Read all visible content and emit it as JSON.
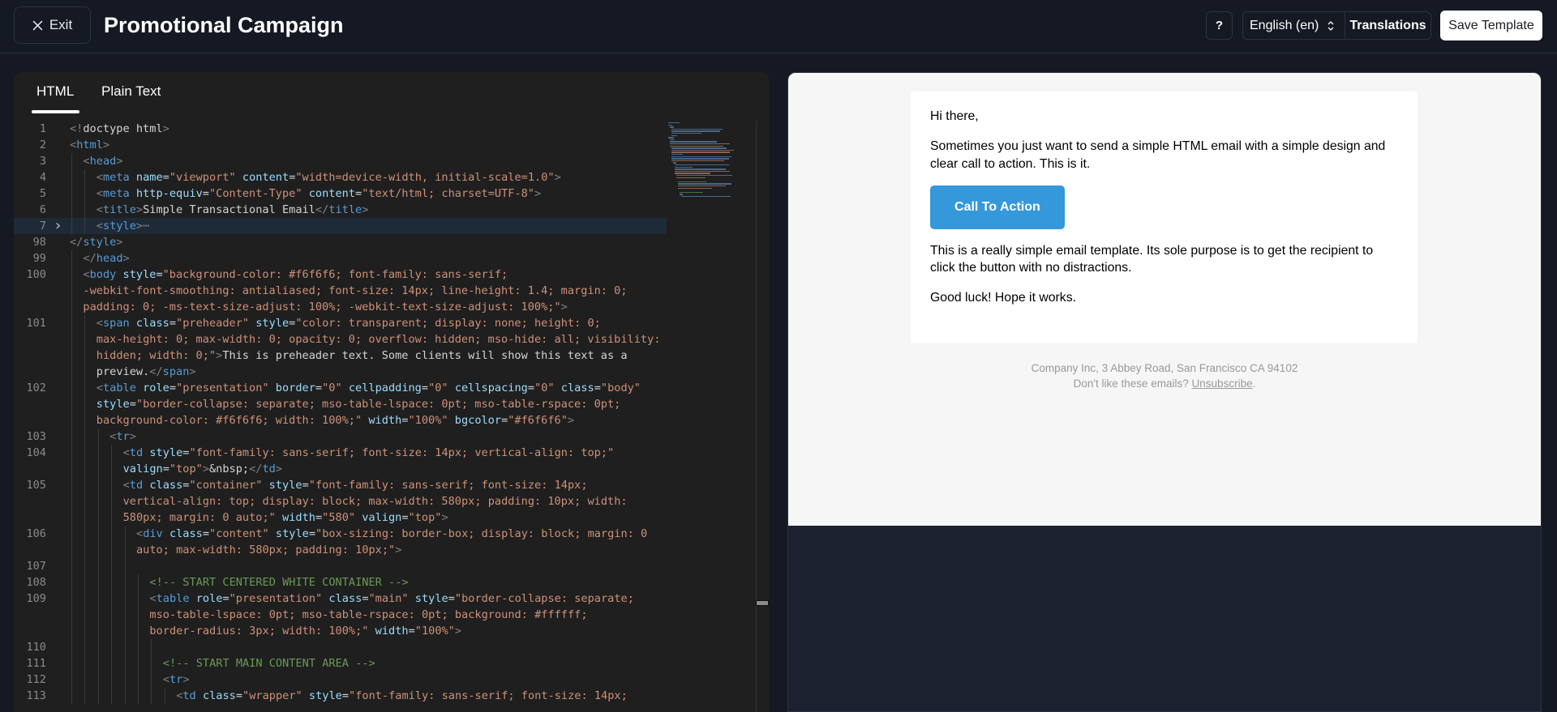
{
  "header": {
    "exit_label": "Exit",
    "title": "Promotional Campaign",
    "help_label": "?",
    "language_selected": "English (en)",
    "translations_label": "Translations",
    "save_label": "Save Template"
  },
  "editor": {
    "tabs": [
      {
        "label": "HTML",
        "active": true
      },
      {
        "label": "Plain Text",
        "active": false
      }
    ],
    "lines": [
      {
        "n": "1",
        "indent": 0,
        "tokens": [
          [
            "p",
            "<!"
          ],
          [
            "txt",
            "doctype html"
          ],
          [
            "p",
            ">"
          ]
        ]
      },
      {
        "n": "2",
        "indent": 0,
        "tokens": [
          [
            "p",
            "<"
          ],
          [
            "tag",
            "html"
          ],
          [
            "p",
            ">"
          ]
        ]
      },
      {
        "n": "3",
        "indent": 1,
        "tokens": [
          [
            "p",
            "<"
          ],
          [
            "tag",
            "head"
          ],
          [
            "p",
            ">"
          ]
        ]
      },
      {
        "n": "4",
        "indent": 2,
        "tokens": [
          [
            "p",
            "<"
          ],
          [
            "tag",
            "meta"
          ],
          [
            "txt",
            " "
          ],
          [
            "attr",
            "name"
          ],
          [
            "txt",
            "="
          ],
          [
            "str",
            "\"viewport\""
          ],
          [
            "txt",
            " "
          ],
          [
            "attr",
            "content"
          ],
          [
            "txt",
            "="
          ],
          [
            "str",
            "\"width=device-width, initial-scale=1.0\""
          ],
          [
            "p",
            ">"
          ]
        ]
      },
      {
        "n": "5",
        "indent": 2,
        "tokens": [
          [
            "p",
            "<"
          ],
          [
            "tag",
            "meta"
          ],
          [
            "txt",
            " "
          ],
          [
            "attr",
            "http-equiv"
          ],
          [
            "txt",
            "="
          ],
          [
            "str",
            "\"Content-Type\""
          ],
          [
            "txt",
            " "
          ],
          [
            "attr",
            "content"
          ],
          [
            "txt",
            "="
          ],
          [
            "str",
            "\"text/html; charset=UTF-8\""
          ],
          [
            "p",
            ">"
          ]
        ]
      },
      {
        "n": "6",
        "indent": 2,
        "tokens": [
          [
            "p",
            "<"
          ],
          [
            "tag",
            "title"
          ],
          [
            "p",
            ">"
          ],
          [
            "txt",
            "Simple Transactional Email"
          ],
          [
            "p",
            "</"
          ],
          [
            "tag",
            "title"
          ],
          [
            "p",
            ">"
          ]
        ]
      },
      {
        "n": "7",
        "indent": 2,
        "fold": true,
        "active": true,
        "tokens": [
          [
            "p",
            "<"
          ],
          [
            "tag",
            "style"
          ],
          [
            "p",
            ">"
          ],
          [
            "p",
            "⋯"
          ]
        ]
      },
      {
        "n": "98",
        "indent": 0,
        "tokens": [
          [
            "p",
            "</"
          ],
          [
            "tag",
            "style"
          ],
          [
            "p",
            ">"
          ]
        ]
      },
      {
        "n": "99",
        "indent": 1,
        "tokens": [
          [
            "p",
            "</"
          ],
          [
            "tag",
            "head"
          ],
          [
            "p",
            ">"
          ]
        ]
      },
      {
        "n": "100",
        "indent": 1,
        "tokens": [
          [
            "p",
            "<"
          ],
          [
            "tag",
            "body"
          ],
          [
            "txt",
            " "
          ],
          [
            "attr",
            "style"
          ],
          [
            "txt",
            "="
          ],
          [
            "str",
            "\"background-color: #f6f6f6; font-family: sans-serif;"
          ]
        ]
      },
      {
        "n": "",
        "indent": 1,
        "tokens": [
          [
            "str",
            "-webkit-font-smoothing: antialiased; font-size: 14px; line-height: 1.4; margin: 0;"
          ]
        ]
      },
      {
        "n": "",
        "indent": 1,
        "tokens": [
          [
            "str",
            "padding: 0; -ms-text-size-adjust: 100%; -webkit-text-size-adjust: 100%;\""
          ],
          [
            "p",
            ">"
          ]
        ]
      },
      {
        "n": "101",
        "indent": 2,
        "tokens": [
          [
            "p",
            "<"
          ],
          [
            "tag",
            "span"
          ],
          [
            "txt",
            " "
          ],
          [
            "attr",
            "class"
          ],
          [
            "txt",
            "="
          ],
          [
            "str",
            "\"preheader\""
          ],
          [
            "txt",
            " "
          ],
          [
            "attr",
            "style"
          ],
          [
            "txt",
            "="
          ],
          [
            "str",
            "\"color: transparent; display: none; height: 0;"
          ]
        ]
      },
      {
        "n": "",
        "indent": 2,
        "tokens": [
          [
            "str",
            "max-height: 0; max-width: 0; opacity: 0; overflow: hidden; mso-hide: all; visibility:"
          ]
        ]
      },
      {
        "n": "",
        "indent": 2,
        "tokens": [
          [
            "str",
            "hidden; width: 0;\""
          ],
          [
            "p",
            ">"
          ],
          [
            "txt",
            "This is preheader text. Some clients will show this text as a"
          ]
        ]
      },
      {
        "n": "",
        "indent": 2,
        "tokens": [
          [
            "txt",
            "preview."
          ],
          [
            "p",
            "</"
          ],
          [
            "tag",
            "span"
          ],
          [
            "p",
            ">"
          ]
        ]
      },
      {
        "n": "102",
        "indent": 2,
        "tokens": [
          [
            "p",
            "<"
          ],
          [
            "tag",
            "table"
          ],
          [
            "txt",
            " "
          ],
          [
            "attr",
            "role"
          ],
          [
            "txt",
            "="
          ],
          [
            "str",
            "\"presentation\""
          ],
          [
            "txt",
            " "
          ],
          [
            "attr",
            "border"
          ],
          [
            "txt",
            "="
          ],
          [
            "str",
            "\"0\""
          ],
          [
            "txt",
            " "
          ],
          [
            "attr",
            "cellpadding"
          ],
          [
            "txt",
            "="
          ],
          [
            "str",
            "\"0\""
          ],
          [
            "txt",
            " "
          ],
          [
            "attr",
            "cellspacing"
          ],
          [
            "txt",
            "="
          ],
          [
            "str",
            "\"0\""
          ],
          [
            "txt",
            " "
          ],
          [
            "attr",
            "class"
          ],
          [
            "txt",
            "="
          ],
          [
            "str",
            "\"body\""
          ]
        ]
      },
      {
        "n": "",
        "indent": 2,
        "tokens": [
          [
            "attr",
            "style"
          ],
          [
            "txt",
            "="
          ],
          [
            "str",
            "\"border-collapse: separate; mso-table-lspace: 0pt; mso-table-rspace: 0pt;"
          ]
        ]
      },
      {
        "n": "",
        "indent": 2,
        "tokens": [
          [
            "str",
            "background-color: #f6f6f6; width: 100%;\""
          ],
          [
            "txt",
            " "
          ],
          [
            "attr",
            "width"
          ],
          [
            "txt",
            "="
          ],
          [
            "str",
            "\"100%\""
          ],
          [
            "txt",
            " "
          ],
          [
            "attr",
            "bgcolor"
          ],
          [
            "txt",
            "="
          ],
          [
            "str",
            "\"#f6f6f6\""
          ],
          [
            "p",
            ">"
          ]
        ]
      },
      {
        "n": "103",
        "indent": 3,
        "tokens": [
          [
            "p",
            "<"
          ],
          [
            "tag",
            "tr"
          ],
          [
            "p",
            ">"
          ]
        ]
      },
      {
        "n": "104",
        "indent": 4,
        "tokens": [
          [
            "p",
            "<"
          ],
          [
            "tag",
            "td"
          ],
          [
            "txt",
            " "
          ],
          [
            "attr",
            "style"
          ],
          [
            "txt",
            "="
          ],
          [
            "str",
            "\"font-family: sans-serif; font-size: 14px; vertical-align: top;\""
          ]
        ]
      },
      {
        "n": "",
        "indent": 4,
        "tokens": [
          [
            "attr",
            "valign"
          ],
          [
            "txt",
            "="
          ],
          [
            "str",
            "\"top\""
          ],
          [
            "p",
            ">"
          ],
          [
            "txt",
            "&nbsp;"
          ],
          [
            "p",
            "</"
          ],
          [
            "tag",
            "td"
          ],
          [
            "p",
            ">"
          ]
        ]
      },
      {
        "n": "105",
        "indent": 4,
        "tokens": [
          [
            "p",
            "<"
          ],
          [
            "tag",
            "td"
          ],
          [
            "txt",
            " "
          ],
          [
            "attr",
            "class"
          ],
          [
            "txt",
            "="
          ],
          [
            "str",
            "\"container\""
          ],
          [
            "txt",
            " "
          ],
          [
            "attr",
            "style"
          ],
          [
            "txt",
            "="
          ],
          [
            "str",
            "\"font-family: sans-serif; font-size: 14px;"
          ]
        ]
      },
      {
        "n": "",
        "indent": 4,
        "tokens": [
          [
            "str",
            "vertical-align: top; display: block; max-width: 580px; padding: 10px; width:"
          ]
        ]
      },
      {
        "n": "",
        "indent": 4,
        "tokens": [
          [
            "str",
            "580px; margin: 0 auto;\""
          ],
          [
            "txt",
            " "
          ],
          [
            "attr",
            "width"
          ],
          [
            "txt",
            "="
          ],
          [
            "str",
            "\"580\""
          ],
          [
            "txt",
            " "
          ],
          [
            "attr",
            "valign"
          ],
          [
            "txt",
            "="
          ],
          [
            "str",
            "\"top\""
          ],
          [
            "p",
            ">"
          ]
        ]
      },
      {
        "n": "106",
        "indent": 5,
        "tokens": [
          [
            "p",
            "<"
          ],
          [
            "tag",
            "div"
          ],
          [
            "txt",
            " "
          ],
          [
            "attr",
            "class"
          ],
          [
            "txt",
            "="
          ],
          [
            "str",
            "\"content\""
          ],
          [
            "txt",
            " "
          ],
          [
            "attr",
            "style"
          ],
          [
            "txt",
            "="
          ],
          [
            "str",
            "\"box-sizing: border-box; display: block; margin: 0"
          ]
        ]
      },
      {
        "n": "",
        "indent": 5,
        "tokens": [
          [
            "str",
            "auto; max-width: 580px; padding: 10px;\""
          ],
          [
            "p",
            ">"
          ]
        ]
      },
      {
        "n": "107",
        "indent": 5,
        "tokens": []
      },
      {
        "n": "108",
        "indent": 6,
        "tokens": [
          [
            "com",
            "<!-- START CENTERED WHITE CONTAINER -->"
          ]
        ]
      },
      {
        "n": "109",
        "indent": 6,
        "tokens": [
          [
            "p",
            "<"
          ],
          [
            "tag",
            "table"
          ],
          [
            "txt",
            " "
          ],
          [
            "attr",
            "role"
          ],
          [
            "txt",
            "="
          ],
          [
            "str",
            "\"presentation\""
          ],
          [
            "txt",
            " "
          ],
          [
            "attr",
            "class"
          ],
          [
            "txt",
            "="
          ],
          [
            "str",
            "\"main\""
          ],
          [
            "txt",
            " "
          ],
          [
            "attr",
            "style"
          ],
          [
            "txt",
            "="
          ],
          [
            "str",
            "\"border-collapse: separate;"
          ]
        ]
      },
      {
        "n": "",
        "indent": 6,
        "tokens": [
          [
            "str",
            "mso-table-lspace: 0pt; mso-table-rspace: 0pt; background: #ffffff;"
          ]
        ]
      },
      {
        "n": "",
        "indent": 6,
        "tokens": [
          [
            "str",
            "border-radius: 3px; width: 100%;\""
          ],
          [
            "txt",
            " "
          ],
          [
            "attr",
            "width"
          ],
          [
            "txt",
            "="
          ],
          [
            "str",
            "\"100%\""
          ],
          [
            "p",
            ">"
          ]
        ]
      },
      {
        "n": "110",
        "indent": 7,
        "tokens": []
      },
      {
        "n": "111",
        "indent": 7,
        "tokens": [
          [
            "com",
            "<!-- START MAIN CONTENT AREA -->"
          ]
        ]
      },
      {
        "n": "112",
        "indent": 7,
        "tokens": [
          [
            "p",
            "<"
          ],
          [
            "tag",
            "tr"
          ],
          [
            "p",
            ">"
          ]
        ]
      },
      {
        "n": "113",
        "indent": 8,
        "tokens": [
          [
            "p",
            "<"
          ],
          [
            "tag",
            "td"
          ],
          [
            "txt",
            " "
          ],
          [
            "attr",
            "class"
          ],
          [
            "txt",
            "="
          ],
          [
            "str",
            "\"wrapper\""
          ],
          [
            "txt",
            " "
          ],
          [
            "attr",
            "style"
          ],
          [
            "txt",
            "="
          ],
          [
            "str",
            "\"font-family: sans-serif; font-size: 14px;"
          ]
        ]
      }
    ]
  },
  "preview": {
    "greeting": "Hi there,",
    "paragraph1": "Sometimes you just want to send a simple HTML email with a simple design and clear call to action. This is it.",
    "cta_label": "Call To Action",
    "paragraph2": "This is a really simple email template. Its sole purpose is to get the recipient to click the button with no distractions.",
    "closing": "Good luck! Hope it works.",
    "footer_address": "Company Inc, 3 Abbey Road, San Francisco CA 94102",
    "footer_prompt": "Don't like these emails?",
    "unsubscribe_label": "Unsubscribe",
    "footer_end": ".",
    "colors": {
      "cta_background": "#3498db",
      "canvas_background": "#f6f6f6",
      "card_background": "#ffffff",
      "footer_text": "#999999"
    }
  }
}
